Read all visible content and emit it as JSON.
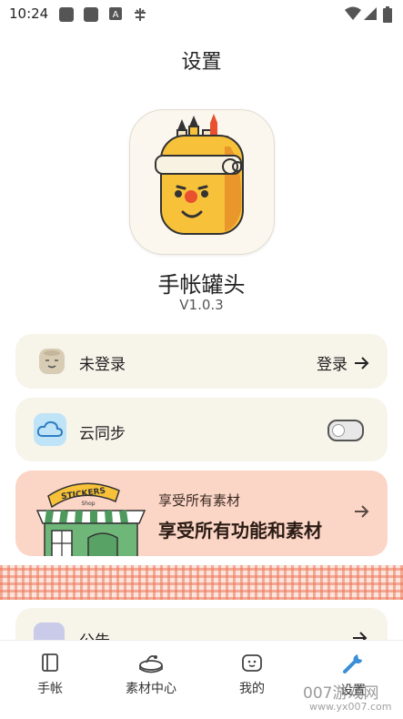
{
  "status_bar": {
    "time": "10:24",
    "left_icons": [
      "gallery-notification-icon",
      "gallery-notification-icon",
      "a-notification-icon",
      "bug-icon"
    ],
    "right_icons": [
      "wifi-icon",
      "signal-icon",
      "battery-icon"
    ]
  },
  "header": {
    "title": "设置"
  },
  "app": {
    "name": "手帐罐头",
    "version": "V1.0.3",
    "icon": "jar-mascot-icon"
  },
  "account": {
    "label": "未登录",
    "action_label": "登录",
    "action_icon": "arrow-right-icon"
  },
  "cloud_sync": {
    "label": "云同步",
    "enabled": false,
    "icon": "cloud-icon"
  },
  "promo": {
    "subtitle": "享受所有素材",
    "title": "享受所有功能和素材",
    "sign_text": "STICKERS",
    "sign_sub": "Shop",
    "icon": "sticker-shop-icon"
  },
  "notice": {
    "label": "公告",
    "icon": "notice-icon"
  },
  "bottom_nav": {
    "items": [
      {
        "label": "手帐",
        "icon": "notebook-icon"
      },
      {
        "label": "素材中心",
        "icon": "material-center-icon"
      },
      {
        "label": "我的",
        "icon": "face-icon"
      },
      {
        "label": "设置",
        "icon": "wrench-icon",
        "active": true
      }
    ]
  },
  "watermark": {
    "text": "007游戏网",
    "url": "www.yx007.com"
  },
  "colors": {
    "card_bg": "#f7f4ea",
    "promo_bg": "#fbd5c6",
    "accent_blue": "#3b8fd6",
    "jar_yellow": "#f7c23a"
  }
}
